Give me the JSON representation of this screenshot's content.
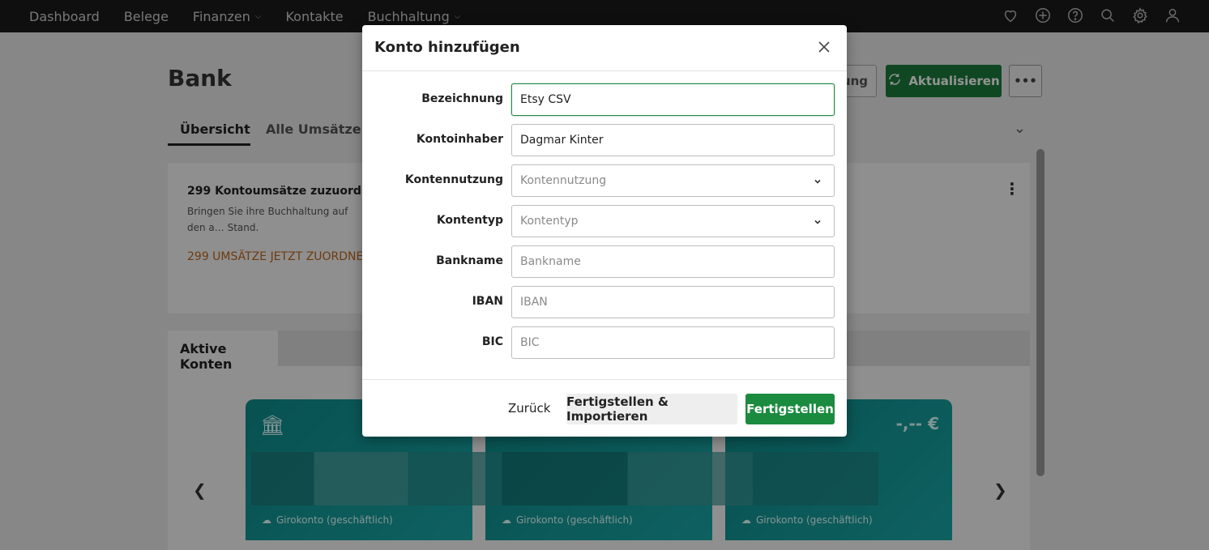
{
  "topnav": {
    "items": [
      {
        "label": "Dashboard",
        "has_caret": false
      },
      {
        "label": "Belege",
        "has_caret": false
      },
      {
        "label": "Finanzen",
        "has_caret": true
      },
      {
        "label": "Kontakte",
        "has_caret": false
      },
      {
        "label": "Buchhaltung",
        "has_caret": true
      }
    ],
    "icons": [
      "heart-icon",
      "plus-circle-icon",
      "help-icon",
      "search-icon",
      "gear-icon",
      "user-icon"
    ]
  },
  "page": {
    "title": "Bank",
    "header_buttons": {
      "partial_label": "ung",
      "refresh_label": "Aktualisieren",
      "more_label": "•••"
    },
    "tabs": [
      "Übersicht",
      "Alle Umsätze"
    ],
    "assign_card": {
      "title": "299 Kontoumsätze zuzuordnen",
      "description": "Bringen Sie ihre Buchhaltung auf den a… Stand.",
      "link": "299 UMSÄTZE JETZT ZUORDNEN"
    },
    "accounts": {
      "tab_label": "Aktive Konten",
      "cards": [
        {
          "subtitle": "Girokonto (geschäftlich)",
          "amount": ""
        },
        {
          "subtitle": "Girokonto (geschäftlich)",
          "amount": ""
        },
        {
          "subtitle": "Girokonto (geschäftlich)",
          "amount": "-,-- €"
        }
      ]
    }
  },
  "modal": {
    "title": "Konto hinzufügen",
    "fields": {
      "bezeichnung": {
        "label": "Bezeichnung",
        "value": "Etsy CSV"
      },
      "kontoinhaber": {
        "label": "Kontoinhaber",
        "value": "Dagmar Kinter"
      },
      "kontennutzung": {
        "label": "Kontennutzung",
        "placeholder": "Kontennutzung"
      },
      "kontentyp": {
        "label": "Kontentyp",
        "placeholder": "Kontentyp"
      },
      "bankname": {
        "label": "Bankname",
        "placeholder": "Bankname"
      },
      "iban": {
        "label": "IBAN",
        "placeholder": "IBAN"
      },
      "bic": {
        "label": "BIC",
        "placeholder": "BIC"
      }
    },
    "footer": {
      "back_label": "Zurück",
      "finish_import_label": "Fertigstellen & Importieren",
      "finish_label": "Fertigstellen"
    }
  },
  "colors": {
    "accent_green": "#1a8b3f",
    "card_teal": "#0e8c8c",
    "link_orange": "#c0661a"
  }
}
